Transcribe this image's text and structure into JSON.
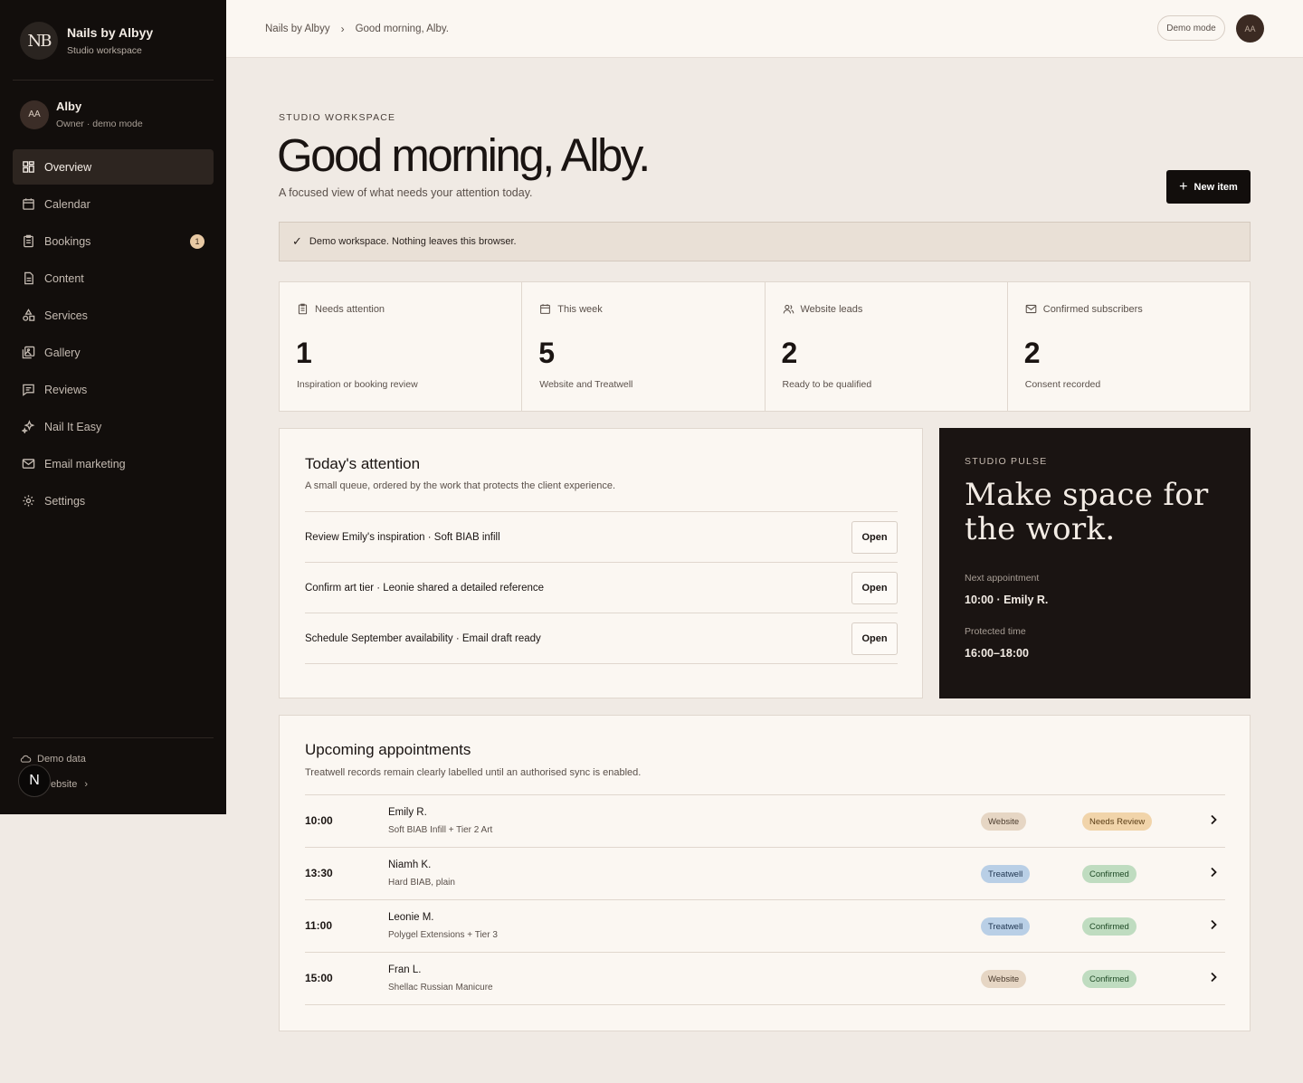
{
  "brand": {
    "monogram": "NB",
    "name": "Nails by Albyy",
    "subtitle": "Studio workspace"
  },
  "user": {
    "initials": "AA",
    "name": "Alby",
    "role": "Owner · demo mode"
  },
  "nav": [
    {
      "label": "Overview",
      "icon": "grid-icon",
      "active": true
    },
    {
      "label": "Calendar",
      "icon": "calendar-icon"
    },
    {
      "label": "Bookings",
      "icon": "clipboard-icon",
      "badge": "1"
    },
    {
      "label": "Content",
      "icon": "document-icon"
    },
    {
      "label": "Services",
      "icon": "shapes-icon"
    },
    {
      "label": "Gallery",
      "icon": "gallery-icon"
    },
    {
      "label": "Reviews",
      "icon": "message-icon"
    },
    {
      "label": "Nail It Easy",
      "icon": "sparkles-icon"
    },
    {
      "label": "Email marketing",
      "icon": "mail-icon"
    },
    {
      "label": "Settings",
      "icon": "gear-icon"
    }
  ],
  "sidebar_footer": {
    "demo_data": "Demo data",
    "website": "ebsite",
    "n_badge": "N"
  },
  "topbar": {
    "crumbs": [
      "Nails by Albyy",
      "Good morning, Alby."
    ],
    "demo_mode": "Demo mode",
    "avatar": "AA"
  },
  "header": {
    "eyebrow": "STUDIO WORKSPACE",
    "title": "Good morning, Alby.",
    "subtitle": "A focused view of what needs your attention today.",
    "new_item": "New item"
  },
  "banner": {
    "text": "Demo workspace. Nothing leaves this browser."
  },
  "stats": [
    {
      "label": "Needs attention",
      "icon": "clipboard-icon",
      "value": "1",
      "sub": "Inspiration or booking review"
    },
    {
      "label": "This week",
      "icon": "calendar-icon",
      "value": "5",
      "sub": "Website and Treatwell"
    },
    {
      "label": "Website leads",
      "icon": "users-icon",
      "value": "2",
      "sub": "Ready to be qualified"
    },
    {
      "label": "Confirmed subscribers",
      "icon": "mail-icon",
      "value": "2",
      "sub": "Consent recorded"
    }
  ],
  "attention": {
    "title": "Today's attention",
    "desc": "A small queue, ordered by the work that protects the client experience.",
    "items": [
      {
        "text": "Review Emily's inspiration · Soft BIAB infill",
        "action": "Open"
      },
      {
        "text": "Confirm art tier · Leonie shared a detailed reference",
        "action": "Open"
      },
      {
        "text": "Schedule September availability · Email draft ready",
        "action": "Open"
      }
    ]
  },
  "pulse": {
    "eyebrow": "STUDIO PULSE",
    "headline": "Make space for the work.",
    "next_label": "Next appointment",
    "next_value": "10:00 · Emily R.",
    "protected_label": "Protected time",
    "protected_value": "16:00–18:00"
  },
  "appointments": {
    "title": "Upcoming appointments",
    "desc": "Treatwell records remain clearly labelled until an authorised sync is enabled.",
    "rows": [
      {
        "time": "10:00",
        "name": "Emily R.",
        "service": "Soft BIAB Infill + Tier 2 Art",
        "source": "Website",
        "source_style": "website",
        "status": "Needs Review",
        "status_style": "review"
      },
      {
        "time": "13:30",
        "name": "Niamh K.",
        "service": "Hard BIAB, plain",
        "source": "Treatwell",
        "source_style": "treatwell",
        "status": "Confirmed",
        "status_style": "confirmed"
      },
      {
        "time": "11:00",
        "name": "Leonie M.",
        "service": "Polygel Extensions + Tier 3",
        "source": "Treatwell",
        "source_style": "treatwell",
        "status": "Confirmed",
        "status_style": "confirmed"
      },
      {
        "time": "15:00",
        "name": "Fran L.",
        "service": "Shellac Russian Manicure",
        "source": "Website",
        "source_style": "website",
        "status": "Confirmed",
        "status_style": "confirmed"
      }
    ]
  }
}
